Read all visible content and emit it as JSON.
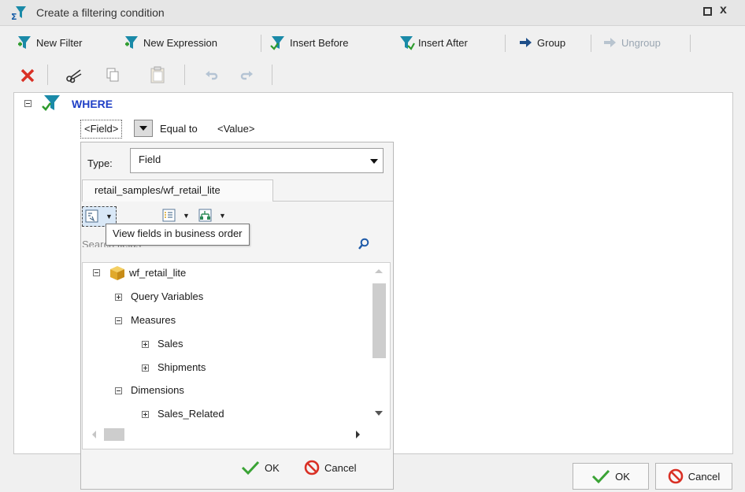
{
  "window": {
    "title": "Create a filtering condition"
  },
  "toolbar": {
    "new_filter": "New Filter",
    "new_expression": "New Expression",
    "insert_before": "Insert Before",
    "insert_after": "Insert After",
    "group": "Group",
    "ungroup": "Ungroup"
  },
  "editor": {
    "where": "WHERE",
    "field_token": "<Field>",
    "operator": "Equal to",
    "value_token": "<Value>"
  },
  "popup": {
    "type_label": "Type:",
    "type_value": "Field",
    "source_tab": "retail_samples/wf_retail_lite",
    "tooltip": "View fields in business order",
    "search_placeholder": "Search fields",
    "tree": {
      "root": "wf_retail_lite",
      "items": [
        "Query Variables",
        "Measures",
        "Sales",
        "Shipments",
        "Dimensions",
        "Sales_Related"
      ]
    },
    "ok": "OK",
    "cancel": "Cancel"
  },
  "dialog": {
    "ok": "OK",
    "cancel": "Cancel"
  },
  "colors": {
    "accent_blue": "#1f3fc6",
    "filter_teal": "#1a8aa8",
    "delete_red": "#d93025",
    "ok_green": "#3aa335"
  }
}
